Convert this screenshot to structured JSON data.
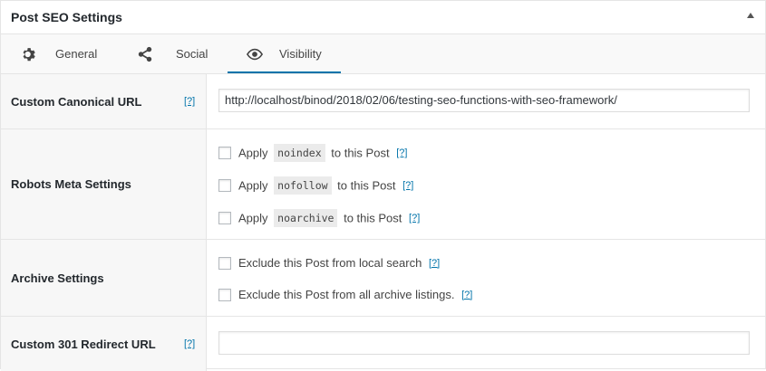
{
  "header": {
    "title": "Post SEO Settings",
    "toggle_icon": "arrow-up-icon"
  },
  "tabs": [
    {
      "label": "General",
      "icon": "gear-icon"
    },
    {
      "label": "Social",
      "icon": "share-icon"
    },
    {
      "label": "Visibility",
      "icon": "eye-icon",
      "active": true
    }
  ],
  "canonical": {
    "label": "Custom Canonical URL",
    "help": "[?]",
    "value": "http://localhost/binod/2018/02/06/testing-seo-functions-with-seo-framework/"
  },
  "robots": {
    "label": "Robots Meta Settings",
    "items": [
      {
        "prefix": "Apply",
        "code": "noindex",
        "suffix": "to this Post",
        "help": "[?]"
      },
      {
        "prefix": "Apply",
        "code": "nofollow",
        "suffix": "to this Post",
        "help": "[?]"
      },
      {
        "prefix": "Apply",
        "code": "noarchive",
        "suffix": "to this Post",
        "help": "[?]"
      }
    ]
  },
  "archive": {
    "label": "Archive Settings",
    "items": [
      {
        "text": "Exclude this Post from local search",
        "help": "[?]"
      },
      {
        "text": "Exclude this Post from all archive listings.",
        "help": "[?]"
      }
    ]
  },
  "redirect": {
    "label": "Custom 301 Redirect URL",
    "help": "[?]",
    "value": ""
  },
  "colors": {
    "accent": "#0073aa",
    "row_bg": "#f7f7f7",
    "border": "#e5e5e5"
  }
}
